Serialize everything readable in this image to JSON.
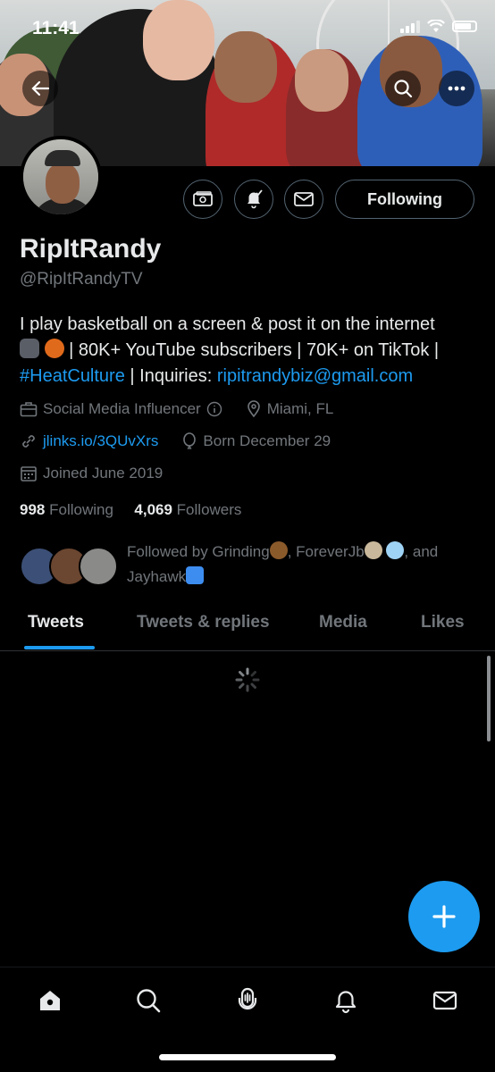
{
  "status_bar": {
    "time": "11:41"
  },
  "profile": {
    "name": "RipItRandy",
    "handle": "@RipItRandyTV",
    "bio": {
      "text1": "I play basketball on a screen & post it on the internet",
      "text2": " | 80K+ YouTube subscribers | 70K+ on TikTok |",
      "hashtag": "#HeatCulture",
      "text3": " | Inquiries: ",
      "email": "ripitrandybiz@gmail.com"
    },
    "category": "Social Media Influencer",
    "location": "Miami, FL",
    "website": "jlinks.io/3QUvXrs",
    "birthday": "Born December 29",
    "joined": "Joined June 2019",
    "following_count": "998",
    "following_label": "Following",
    "followers_count": "4,069",
    "followers_label": "Followers",
    "followed_by_text1": "Followed by Grinding",
    "followed_by_text2": ", ForeverJb",
    "followed_by_text3": ", and",
    "followed_by_text4": "Jayhawk"
  },
  "actions": {
    "follow_label": "Following"
  },
  "tabs": [
    {
      "label": "Tweets"
    },
    {
      "label": "Tweets & replies"
    },
    {
      "label": "Media"
    },
    {
      "label": "Likes"
    }
  ],
  "colors": {
    "accent": "#1d9bf0",
    "background": "#000000",
    "secondary_text": "#71767b"
  },
  "icons": {
    "back": "arrow-left-icon",
    "search": "search-icon",
    "more": "more-icon",
    "subscribe": "ticket-icon",
    "notify": "bell-icon",
    "message": "mail-icon",
    "compose": "plus-icon",
    "nav": [
      "home-icon",
      "search-icon",
      "spaces-icon",
      "notifications-icon",
      "messages-icon"
    ]
  }
}
